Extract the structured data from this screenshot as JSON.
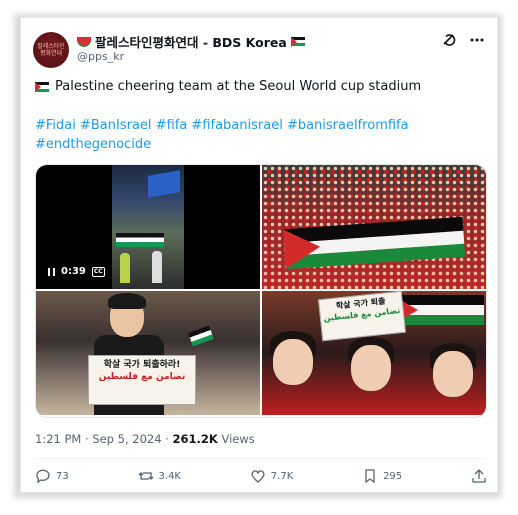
{
  "author": {
    "name": "팔레스타인평화연대 - BDS Korea",
    "handle": "@pps_kr",
    "avatar_text": "팔레스타인평화연대"
  },
  "tweet": {
    "text": "Palestine cheering team at the Seoul World cup stadium",
    "hashtags": "#Fidai #BanIsrael #fifa #fifabanisrael #banisraelfromfifa #endthegenocide"
  },
  "media": {
    "video_time": "0:39",
    "video_cc": "CC",
    "sign1_line1": "학살 국가 퇴출하라!",
    "sign1_line2": "تضامن مع فلسطين",
    "sign2_line1": "학살 국가 퇴출",
    "sign2_line2": "تضامن مع فلسطين"
  },
  "meta": {
    "time": "1:21 PM · Sep 5, 2024 ·",
    "views_count": "261.2K",
    "views_label": "Views"
  },
  "actions": {
    "replies": "73",
    "reposts": "3.4K",
    "likes": "7.7K",
    "bookmarks": "295"
  },
  "colors": {
    "link": "#1d9bf0",
    "text": "#0f1419",
    "muted": "#536471"
  }
}
